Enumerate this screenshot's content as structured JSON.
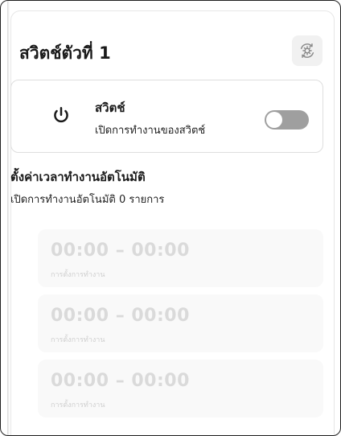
{
  "header": {
    "title": "สวิตช์ตัวที่ 1"
  },
  "switch": {
    "label": "สวิตช์",
    "description": "เปิดการทำงานของสวิตช์",
    "state": "off",
    "icon": "power-icon"
  },
  "schedule": {
    "title": "ตั้งค่าเวลาทำงานอัตโนมัติ",
    "summary": "เปิดการทำงานอัตโนมัติ 0 รายการ",
    "items": [
      {
        "time": "00:00 – 00:00",
        "label": "การตั้งการทำงาน"
      },
      {
        "time": "00:00 – 00:00",
        "label": "การตั้งการทำงาน"
      },
      {
        "time": "00:00 – 00:00",
        "label": "การตั้งการทำงาน"
      }
    ]
  },
  "colors": {
    "toggle_off": "#9f9f9f",
    "placeholder_text": "#dadada",
    "item_background": "#f9f9f9"
  }
}
